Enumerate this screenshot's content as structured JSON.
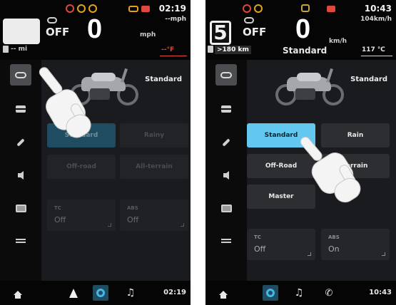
{
  "colors": {
    "accent": "#63c8ef",
    "warning_red": "#e0473d",
    "warning_amber": "#e3a21a",
    "green": "#43b34a",
    "background": "#1a1b1e"
  },
  "left": {
    "status": {
      "off_label": "OFF",
      "speed": "0",
      "speed_unit": "mph",
      "top_unit": "--mph",
      "clock": "02:19",
      "range": "-- mi",
      "temp": "--°F"
    },
    "sidebar_icons": [
      "bike-icon",
      "info-card-icon",
      "wrench-icon",
      "speaker-icon",
      "display-icon",
      "sliders-icon"
    ],
    "hero_label": "Standard",
    "modes": [
      "Standard",
      "Rainy",
      "Off-road",
      "All-terrain"
    ],
    "cards": [
      {
        "label": "TC",
        "value": "Off"
      },
      {
        "label": "ABS",
        "value": "Off"
      }
    ],
    "bottom_clock": "02:19"
  },
  "right": {
    "status": {
      "gear": "5",
      "off_label": "OFF",
      "speed": "0",
      "speed_unit": "km/h",
      "top_unit": "104km/h",
      "clock": "10:43",
      "range": ">180 km",
      "mode": "Standard",
      "temp": "117 ℃"
    },
    "sidebar_icons": [
      "bike-icon",
      "info-card-icon",
      "wrench-icon",
      "speaker-icon",
      "display-icon",
      "sliders-icon"
    ],
    "hero_label": "Standard",
    "modes": [
      "Standard",
      "Rain",
      "Off-Road",
      "terrain",
      "Master"
    ],
    "cards": [
      {
        "label": "TC",
        "value": "Off"
      },
      {
        "label": "ABS",
        "value": "On"
      }
    ],
    "bottom_clock": "10:43"
  }
}
